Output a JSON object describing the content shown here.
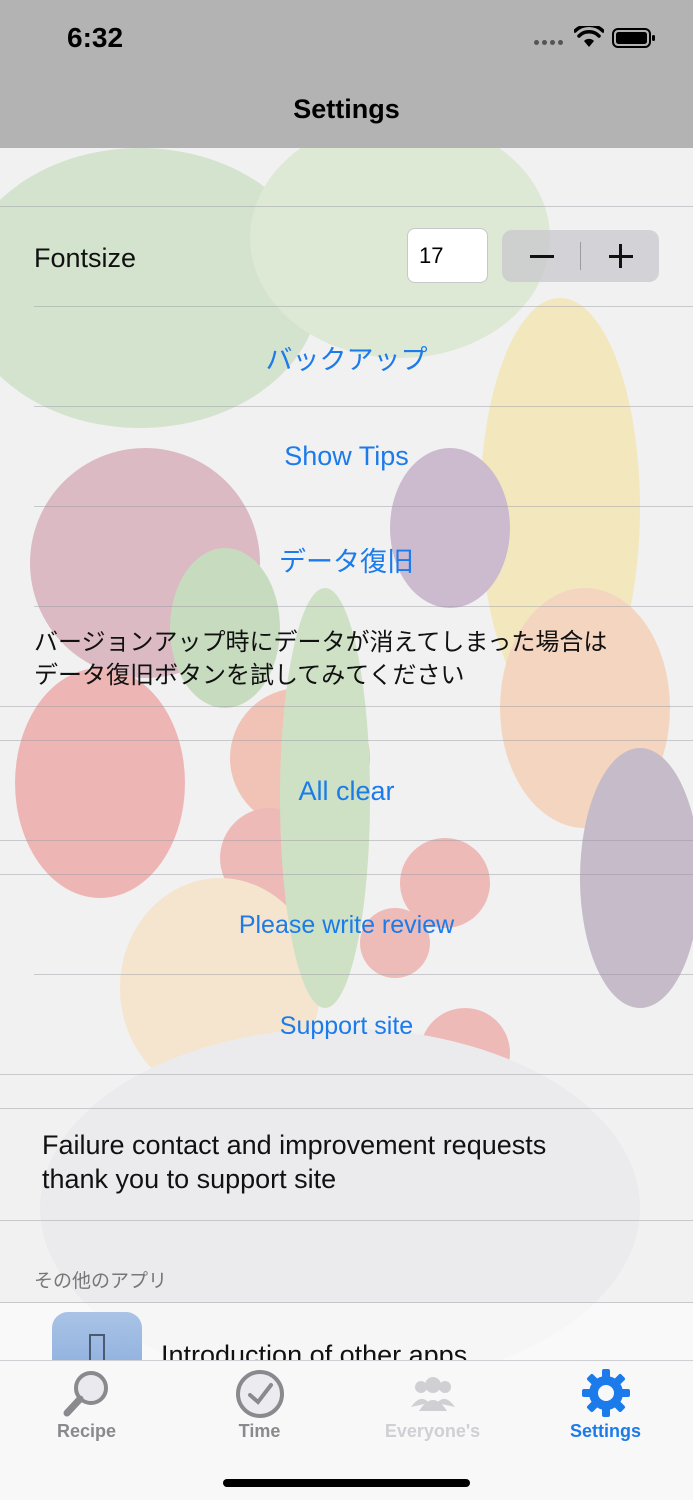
{
  "status": {
    "time": "6:32"
  },
  "nav": {
    "title": "Settings"
  },
  "settings": {
    "fontsize_label": "Fontsize",
    "fontsize_value": "17",
    "backup_label": "バックアップ",
    "show_tips_label": "Show Tips",
    "restore_label": "データ復旧",
    "restore_note_line1": "バージョンアップ時にデータが消えてしまった場合は",
    "restore_note_line2": "データ復旧ボタンを試してみてください",
    "all_clear_label": "All clear",
    "review_label": "Please write review",
    "support_label": "Support site",
    "support_note_line1": "Failure contact and improvement requests",
    "support_note_line2": "thank you to support site"
  },
  "other_apps": {
    "header": "その他のアプリ",
    "row_label": "Introduction of other apps"
  },
  "tabbar": {
    "tabs": [
      {
        "label": "Recipe",
        "icon": "magnifier-icon"
      },
      {
        "label": "Time",
        "icon": "clock-icon"
      },
      {
        "label": "Everyone's",
        "icon": "people-icon"
      },
      {
        "label": "Settings",
        "icon": "gear-icon"
      }
    ],
    "active_color": "#1b7bea",
    "inactive_color": "#8a8a8e",
    "disabled_color": "#d0d0d4"
  },
  "colors": {
    "link": "#1b7bea",
    "navbar": "#b3b3b3"
  }
}
